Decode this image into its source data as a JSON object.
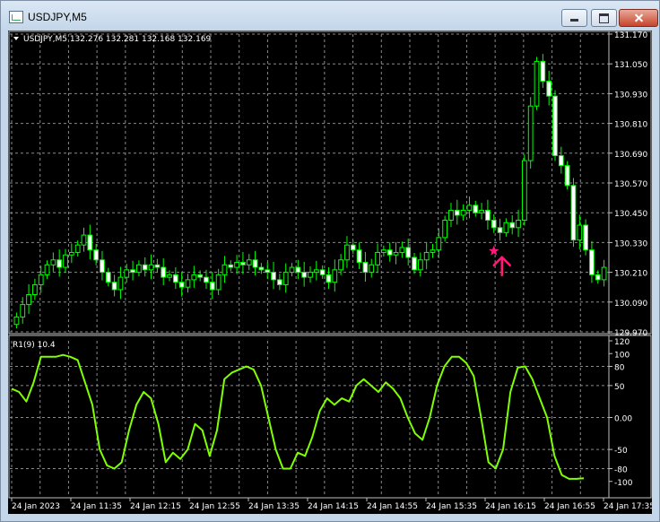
{
  "window": {
    "title": "USDJPY,M5"
  },
  "chart_header": "USDJPY,M5  132.276 132.281 132.168 132.169",
  "indicator_label": "R1(9) 10.4",
  "colors": {
    "background": "#000000",
    "candle": "#00ff00",
    "candle_bull_body": "#000000",
    "candle_bear_body": "#ffffff",
    "grid": "#8a8a8a",
    "indicator_line": "#7fff00",
    "annotation": "#ff1a7a",
    "axis_text": "#ffffff"
  },
  "icons": [
    "app-chart-icon",
    "minimize-icon",
    "maximize-icon",
    "close-icon",
    "dropdown-triangle-icon",
    "star-marker-icon",
    "up-arrow-icon"
  ],
  "chart_data": [
    {
      "type": "candlestick",
      "symbol": "USDJPY",
      "timeframe": "M5",
      "ylim": [
        129.97,
        131.17
      ],
      "y_ticks": [
        "131.170",
        "131.050",
        "130.930",
        "130.810",
        "130.690",
        "130.570",
        "130.450",
        "130.330",
        "130.210",
        "130.090",
        "129.970"
      ],
      "x_ticks": [
        "24 Jan 2023",
        "24 Jan 11:35",
        "24 Jan 12:15",
        "24 Jan 12:55",
        "24 Jan 13:35",
        "24 Jan 14:15",
        "24 Jan 14:55",
        "24 Jan 15:35",
        "24 Jan 16:15",
        "24 Jan 16:55",
        "24 Jan 17:35"
      ],
      "grid": true,
      "close": [
        130.03,
        130.08,
        130.12,
        130.16,
        130.2,
        130.24,
        130.26,
        130.23,
        130.28,
        130.29,
        130.32,
        130.36,
        130.3,
        130.26,
        130.21,
        130.17,
        130.14,
        130.19,
        130.22,
        130.21,
        130.24,
        130.22,
        130.24,
        130.23,
        130.19,
        130.2,
        130.17,
        130.15,
        130.18,
        130.2,
        130.19,
        130.17,
        130.14,
        130.2,
        130.24,
        130.23,
        130.25,
        130.24,
        130.26,
        130.23,
        130.22,
        130.21,
        130.18,
        130.16,
        130.21,
        130.23,
        130.21,
        130.19,
        130.21,
        130.22,
        130.2,
        130.17,
        130.22,
        130.26,
        130.32,
        130.3,
        130.25,
        130.21,
        130.24,
        130.29,
        130.3,
        130.28,
        130.29,
        130.31,
        130.27,
        130.22,
        130.26,
        130.29,
        130.3,
        130.35,
        130.42,
        130.46,
        130.44,
        130.46,
        130.48,
        130.45,
        130.46,
        130.42,
        130.39,
        130.37,
        130.41,
        130.39,
        130.42,
        130.66,
        130.88,
        131.06,
        130.98,
        130.92,
        130.68,
        130.64,
        130.56,
        130.34,
        130.4,
        130.3,
        130.2,
        130.18,
        130.23
      ],
      "annotations": [
        {
          "type": "star-and-arrow",
          "candle_index": 78
        }
      ]
    },
    {
      "type": "line",
      "name": "R1(9)",
      "value_label": "10.4",
      "ylim": [
        -120,
        120
      ],
      "y_ticks": [
        "120",
        "100",
        "80",
        "50",
        "0.00",
        "-50",
        "-80",
        "-100"
      ],
      "reference_lines": [
        80,
        50,
        0,
        -50,
        -80
      ],
      "grid": true,
      "values": [
        45,
        40,
        25,
        55,
        95,
        95,
        95,
        98,
        95,
        90,
        55,
        20,
        -50,
        -75,
        -80,
        -70,
        -20,
        20,
        40,
        30,
        -10,
        -70,
        -55,
        -65,
        -50,
        -10,
        -20,
        -60,
        -20,
        60,
        70,
        75,
        80,
        75,
        50,
        0,
        -50,
        -80,
        -80,
        -55,
        -60,
        -30,
        10,
        30,
        20,
        30,
        25,
        50,
        60,
        50,
        40,
        55,
        45,
        30,
        0,
        -25,
        -35,
        0,
        50,
        80,
        95,
        95,
        85,
        65,
        0,
        -70,
        -80,
        -50,
        40,
        78,
        80,
        60,
        30,
        0,
        -60,
        -90,
        -96,
        -96,
        -95
      ],
      "title": ""
    }
  ]
}
